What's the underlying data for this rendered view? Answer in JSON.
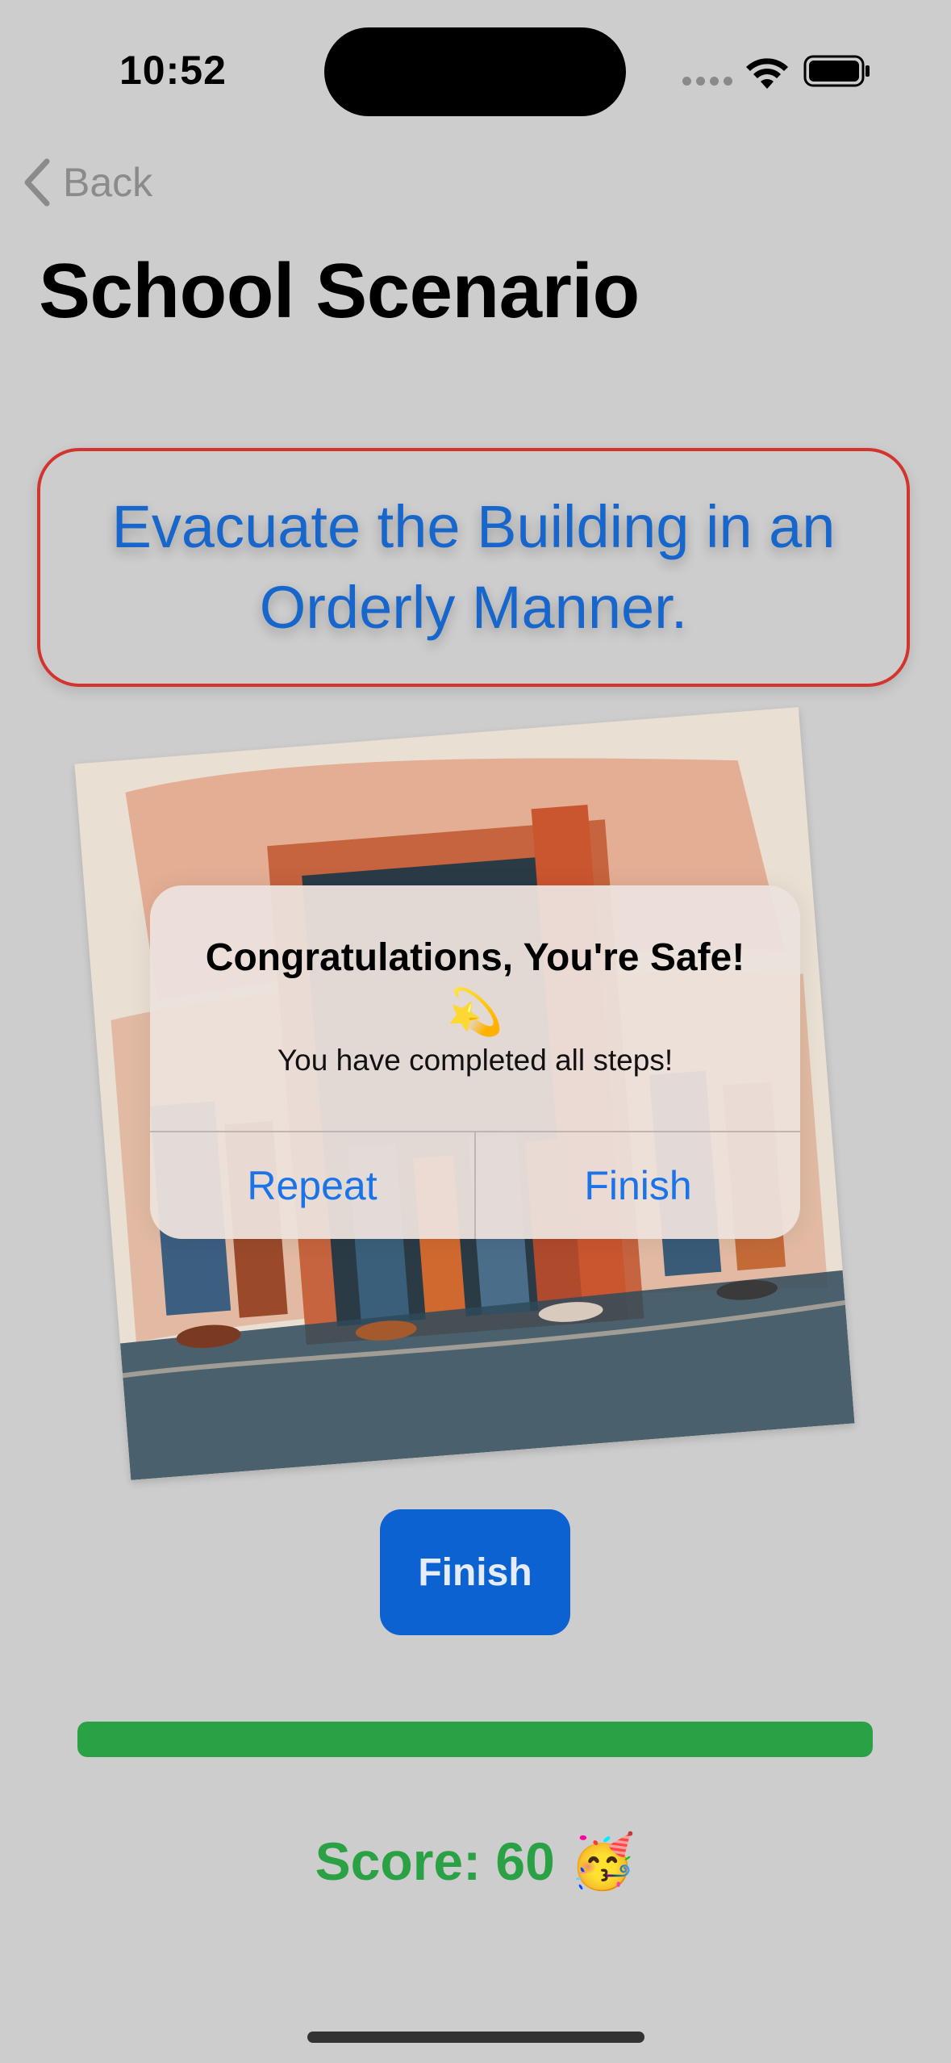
{
  "status_bar": {
    "time": "10:52",
    "icons": [
      "cellular-signal-icon",
      "wifi-icon",
      "battery-icon"
    ]
  },
  "nav": {
    "back_label": "Back",
    "title": "School Scenario"
  },
  "instruction": {
    "text": "Evacuate the Building in an Orderly Manner."
  },
  "illustration": {
    "icon": "evacuation-illustration"
  },
  "alert": {
    "title": "Congratulations, You're Safe!",
    "emoji": "💫",
    "message": "You have completed all steps!",
    "buttons": [
      "Repeat",
      "Finish"
    ]
  },
  "main": {
    "finish_label": "Finish",
    "progress": 1.0,
    "score_text": "Score: 60 🥳"
  },
  "colors": {
    "background": "#cdcdcd",
    "accent_blue": "#0d62d1",
    "instruction_text": "#1766cc",
    "instruction_border": "#d3342d",
    "progress_green": "#2ba146"
  }
}
